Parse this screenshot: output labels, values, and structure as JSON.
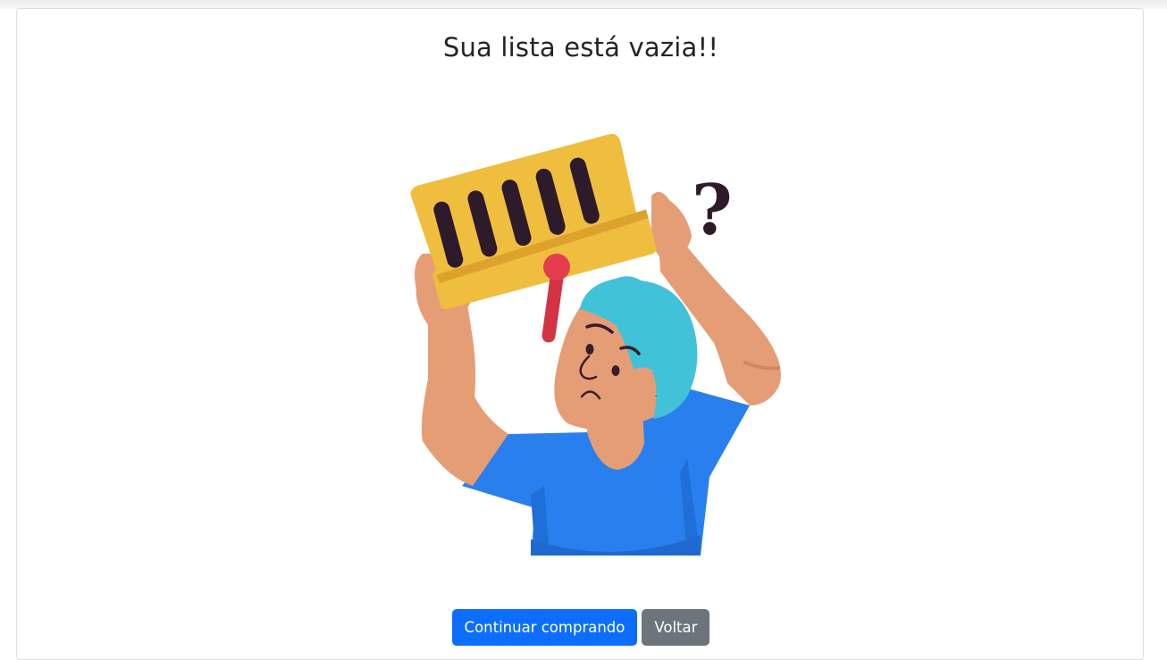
{
  "empty_state": {
    "title": "Sua lista está vazia!!",
    "illustration": "person-holding-empty-basket-icon"
  },
  "actions": {
    "continue_label": "Continuar comprando",
    "back_label": "Voltar"
  },
  "colors": {
    "primary": "#0d6efd",
    "secondary": "#6c757d",
    "basket": "#f0be3f",
    "shirt": "#2a7fef",
    "hair": "#42c2d8",
    "skin": "#e59d76"
  }
}
